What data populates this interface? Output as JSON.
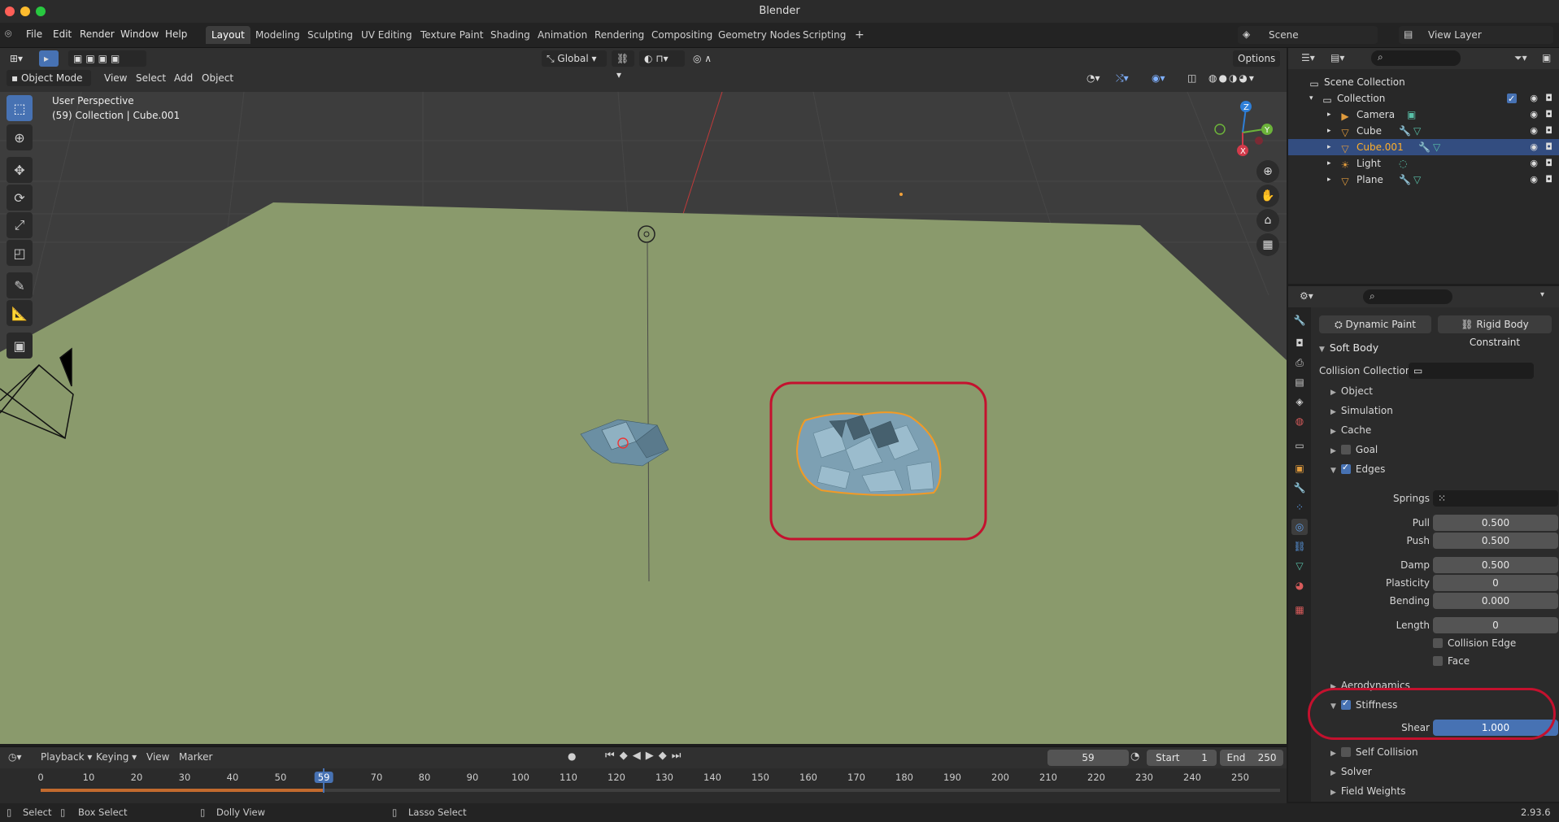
{
  "window": {
    "title": "Blender"
  },
  "menu": [
    "File",
    "Edit",
    "Render",
    "Window",
    "Help"
  ],
  "workspaces": [
    "Layout",
    "Modeling",
    "Sculpting",
    "UV Editing",
    "Texture Paint",
    "Shading",
    "Animation",
    "Rendering",
    "Compositing",
    "Geometry Nodes",
    "Scripting"
  ],
  "active_workspace": "Layout",
  "scene": {
    "label": "Scene",
    "view_layer": "View Layer"
  },
  "viewport_header": {
    "mode": "Object Mode",
    "menus": [
      "View",
      "Select",
      "Add",
      "Object"
    ],
    "orientation": "Global",
    "options": "Options"
  },
  "viewport": {
    "perspective": "User Perspective",
    "info": "(59) Collection | Cube.001",
    "gizmo_axes": [
      "Z",
      "Y",
      "X"
    ]
  },
  "outliner": {
    "root": "Scene Collection",
    "collection": "Collection",
    "items": [
      {
        "name": "Camera",
        "icon_color": "#e09b3d",
        "selected": false
      },
      {
        "name": "Cube",
        "icon_color": "#e09b3d",
        "selected": false
      },
      {
        "name": "Cube.001",
        "icon_color": "#e09b3d",
        "selected": true
      },
      {
        "name": "Light",
        "icon_color": "#e09b3d",
        "selected": false
      },
      {
        "name": "Plane",
        "icon_color": "#e09b3d",
        "selected": false
      }
    ]
  },
  "properties": {
    "buttons": [
      "Dynamic Paint",
      "Rigid Body Constraint"
    ],
    "panel": "Soft Body",
    "collision_collection": "Collision Collection",
    "subpanels": {
      "object": "Object",
      "simulation": "Simulation",
      "cache": "Cache",
      "goal": "Goal",
      "edges": "Edges",
      "aerodynamics": "Aerodynamics",
      "stiffness": "Stiffness",
      "self_collision": "Self Collision",
      "solver": "Solver",
      "field_weights": "Field Weights"
    },
    "edges": {
      "springs": "Springs",
      "pull_label": "Pull",
      "pull": "0.500",
      "push_label": "Push",
      "push": "0.500",
      "damp_label": "Damp",
      "damp": "0.500",
      "plasticity_label": "Plasticity",
      "plasticity": "0",
      "bending_label": "Bending",
      "bending": "0.000",
      "length_label": "Length",
      "length": "0",
      "collision_edge": "Collision Edge",
      "face": "Face"
    },
    "stiffness": {
      "shear_label": "Shear",
      "shear": "1.000"
    }
  },
  "timeline": {
    "menus": [
      "Playback",
      "Keying",
      "View",
      "Marker"
    ],
    "current_frame": "59",
    "start_label": "Start",
    "start": "1",
    "end_label": "End",
    "end": "250",
    "ticks": [
      "0",
      "10",
      "20",
      "30",
      "40",
      "50",
      "59",
      "70",
      "80",
      "90",
      "100",
      "110",
      "120",
      "130",
      "140",
      "150",
      "160",
      "170",
      "180",
      "190",
      "200",
      "210",
      "220",
      "230",
      "240",
      "250"
    ]
  },
  "statusbar": {
    "select": "Select",
    "box_select": "Box Select",
    "dolly_view": "Dolly View",
    "lasso_select": "Lasso Select",
    "version": "2.93.6"
  },
  "colors": {
    "accent": "#4772b3",
    "annotation": "#c4112e",
    "selection_outline": "#f29a26",
    "ground": "#8a9a6c"
  }
}
